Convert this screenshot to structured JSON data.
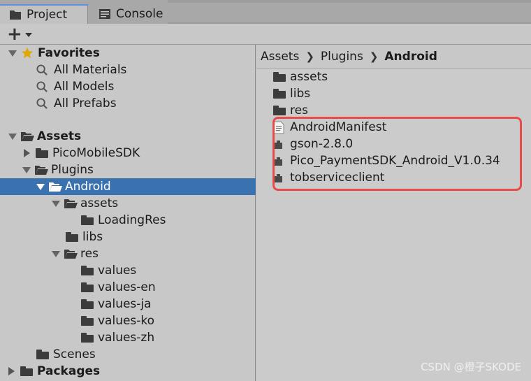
{
  "tabs": {
    "project": "Project",
    "console": "Console"
  },
  "toolbar": {
    "add_label": "+"
  },
  "favorites": {
    "label": "Favorites",
    "items": [
      "All Materials",
      "All Models",
      "All Prefabs"
    ]
  },
  "tree": {
    "assets": "Assets",
    "picomobilesdk": "PicoMobileSDK",
    "plugins": "Plugins",
    "android": "Android",
    "assets_sub": "assets",
    "loadingres": "LoadingRes",
    "libs": "libs",
    "res": "res",
    "values": [
      "values",
      "values-en",
      "values-ja",
      "values-ko",
      "values-zh"
    ],
    "scenes": "Scenes",
    "packages": "Packages"
  },
  "breadcrumb": [
    "Assets",
    "Plugins",
    "Android"
  ],
  "files": {
    "folders": [
      "assets",
      "libs",
      "res"
    ],
    "manifest": "AndroidManifest",
    "plugins": [
      "gson-2.8.0",
      "Pico_PaymentSDK_Android_V1.0.34",
      "tobserviceclient"
    ]
  },
  "watermark": "CSDN @橙子SKODE",
  "colors": {
    "selection": "#3a72b0",
    "highlight": "#e94a4a",
    "accent_star": "#e0a800"
  }
}
